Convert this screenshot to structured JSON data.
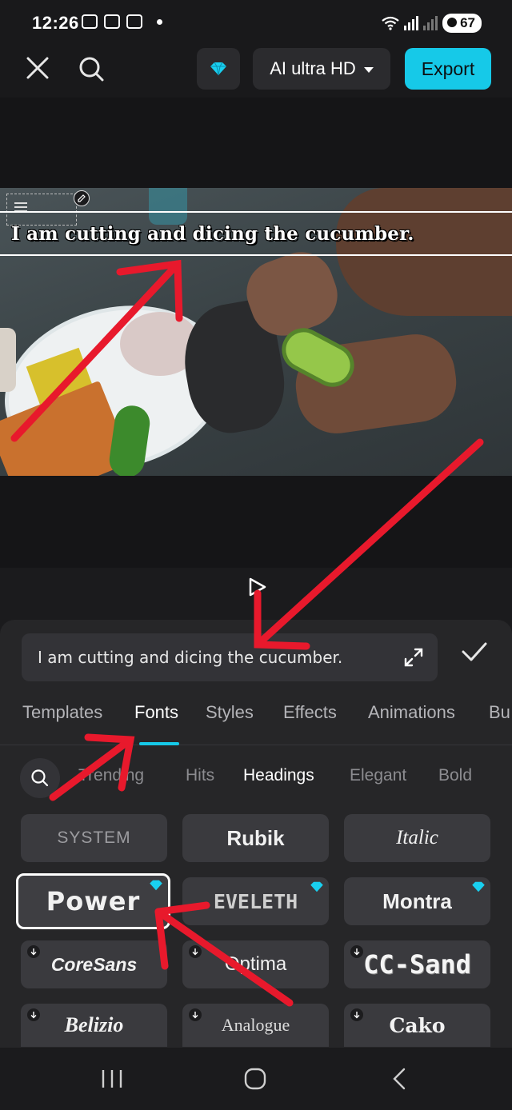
{
  "status_bar": {
    "time": "12:26",
    "battery": "67",
    "network": "5"
  },
  "toolbar": {
    "quality_label": "AI ultra HD",
    "export_label": "Export"
  },
  "preview": {
    "caption_text": "I am cutting and dicing the cucumber."
  },
  "panel": {
    "input_value": "I am cutting and dicing the cucumber.",
    "tabs": [
      "Templates",
      "Fonts",
      "Styles",
      "Effects",
      "Animations",
      "Bu"
    ],
    "active_tab": "Fonts",
    "categories": [
      "Trending",
      "Hits",
      "Headings",
      "Elegant",
      "Bold"
    ],
    "active_category": "Headings",
    "fonts": [
      {
        "label": "SYSTEM",
        "pro": false,
        "download": false
      },
      {
        "label": "Rubik",
        "pro": false,
        "download": false
      },
      {
        "label": "Italic",
        "pro": false,
        "download": false
      },
      {
        "label": "Power",
        "pro": true,
        "download": false,
        "selected": true
      },
      {
        "label": "EVELETH",
        "pro": true,
        "download": false
      },
      {
        "label": "Montra",
        "pro": true,
        "download": false
      },
      {
        "label": "CoreSans",
        "pro": false,
        "download": true
      },
      {
        "label": "Optima",
        "pro": false,
        "download": true
      },
      {
        "label": "CC-Sand",
        "pro": false,
        "download": true
      },
      {
        "label": "Belizio",
        "pro": false,
        "download": true
      },
      {
        "label": "Analogue",
        "pro": false,
        "download": true
      },
      {
        "label": "Cako",
        "pro": false,
        "download": true
      }
    ]
  },
  "colors": {
    "accent": "#16c9e8",
    "annotation_arrow": "#e8192c",
    "background": "#1b1b1d",
    "panel": "#262628"
  },
  "icons": [
    "close-icon",
    "search-icon",
    "diamond-icon",
    "chevron-down-icon",
    "play-icon",
    "expand-icon",
    "check-icon",
    "edit-icon",
    "download-icon",
    "recents-icon",
    "home-icon",
    "back-icon"
  ]
}
